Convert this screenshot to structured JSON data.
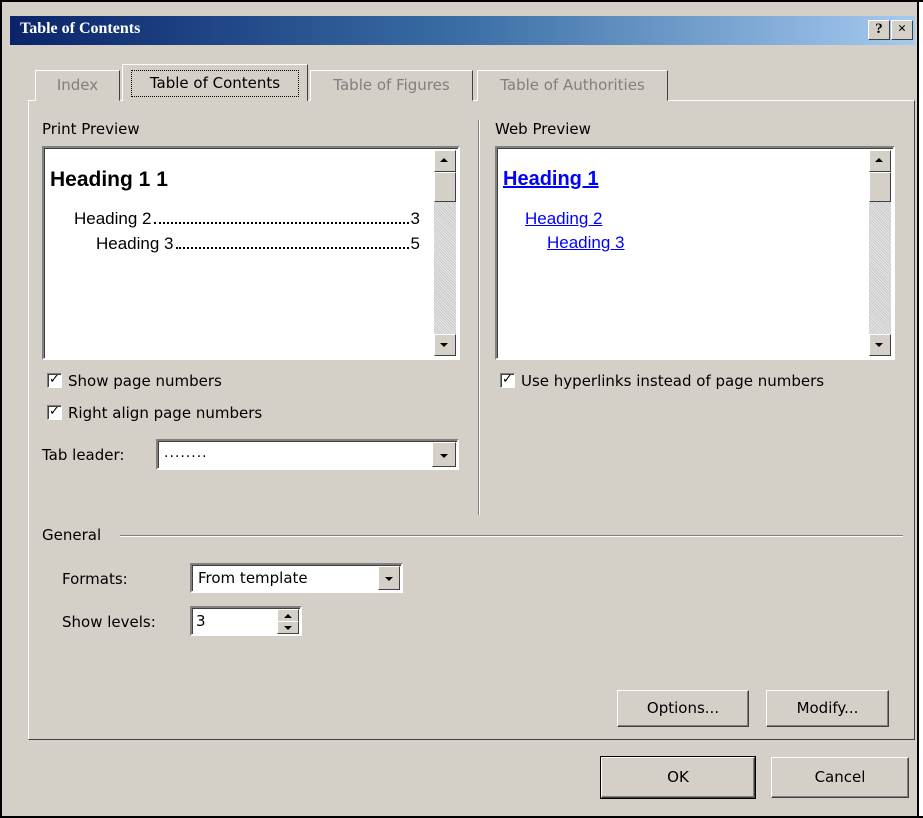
{
  "window": {
    "title": "Table of Contents",
    "help_glyph": "?",
    "close_glyph": "×"
  },
  "tabs": [
    {
      "label": "Index",
      "active": false
    },
    {
      "label": "Table of Contents",
      "active": true
    },
    {
      "label": "Table of Figures",
      "active": false
    },
    {
      "label": "Table of Authorities",
      "active": false
    }
  ],
  "print_preview": {
    "label": "Print Preview",
    "heading1": "Heading 1 1",
    "heading2": "Heading 2",
    "heading2_page": "3",
    "heading3": "Heading 3",
    "heading3_page": "5"
  },
  "web_preview": {
    "label": "Web Preview",
    "heading1": "Heading 1",
    "heading2": "Heading 2",
    "heading3": "Heading 3"
  },
  "options": {
    "show_page_numbers": {
      "label": "Show page numbers",
      "checked": true
    },
    "right_align": {
      "label": "Right align page numbers",
      "checked": true
    },
    "tab_leader": {
      "label": "Tab leader:",
      "value": "........"
    },
    "use_hyperlinks": {
      "label": "Use hyperlinks instead of page numbers",
      "checked": true
    }
  },
  "general": {
    "label": "General",
    "formats_label": "Formats:",
    "formats_value": "From template",
    "levels_label": "Show levels:",
    "levels_value": "3"
  },
  "buttons": {
    "options": "Options...",
    "modify": "Modify...",
    "ok": "OK",
    "cancel": "Cancel"
  },
  "colors": {
    "face": "#d4d0c8",
    "title_start": "#0a246a",
    "link": "#0000ff"
  }
}
